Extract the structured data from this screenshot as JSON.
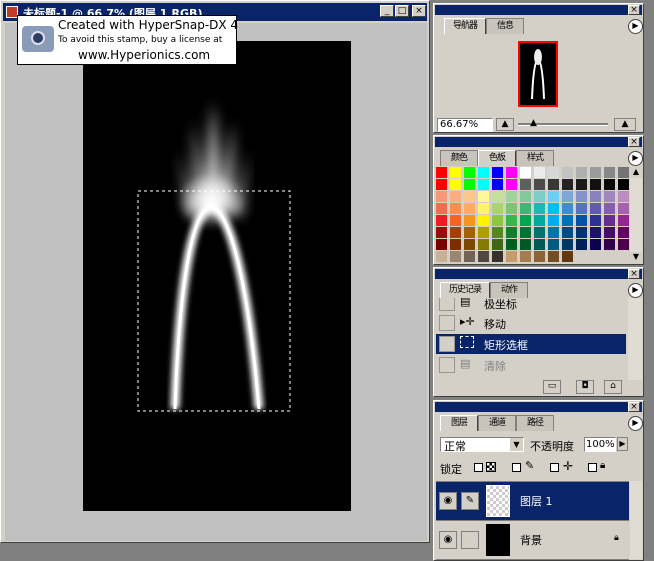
{
  "document_window": {
    "title": "未标题-1 @ 66.7% (图层 1,RGB)",
    "controls": [
      "_",
      "□",
      "×"
    ],
    "watermark": {
      "line1": "Created with HyperSnap-DX 4",
      "line2": "To avoid this stamp, buy a license at",
      "line3": "www.Hyperionics.com"
    }
  },
  "navigator_panel": {
    "tabs": [
      "导航器",
      "信息"
    ],
    "zoom_value": "66.67%",
    "menu_arrow": "▶"
  },
  "swatches_panel": {
    "tabs": [
      "颜色",
      "色板",
      "样式"
    ],
    "colors": [
      [
        "#ff0000",
        "#ffff00",
        "#00ff00",
        "#00ffff",
        "#0000ff",
        "#ff00ff",
        "#ffffff",
        "#ebebeb",
        "#d7d7d7",
        "#c3c3c3",
        "#afafaf",
        "#9b9b9b",
        "#878787",
        "#737373"
      ],
      [
        "#ff0000",
        "#ffff00",
        "#00ff00",
        "#00ffff",
        "#0000ff",
        "#ff00ff",
        "#5f5f5f",
        "#4b4b4b",
        "#373737",
        "#232323",
        "#1a1a1a",
        "#101010",
        "#080808",
        "#000000"
      ],
      [
        "#f7977a",
        "#fbad82",
        "#fdc68c",
        "#fff799",
        "#c4df9b",
        "#a3d39c",
        "#82ca9d",
        "#7bcdc8",
        "#6ecff6",
        "#7ea7d8",
        "#8493ca",
        "#8882be",
        "#a187be",
        "#bc8dbf"
      ],
      [
        "#f26c4f",
        "#f68e55",
        "#fbaf5c",
        "#fff467",
        "#acd372",
        "#7cc576",
        "#3bb878",
        "#1abbb4",
        "#00bff3",
        "#438ccb",
        "#5574b9",
        "#605ca9",
        "#855fa8",
        "#a763a9"
      ],
      [
        "#ed1c24",
        "#f26522",
        "#f7941d",
        "#fff200",
        "#8dc63f",
        "#39b54a",
        "#00a651",
        "#00a99d",
        "#00aeef",
        "#0072bc",
        "#0054a6",
        "#2e3192",
        "#662d91",
        "#92278f"
      ],
      [
        "#9e0b0f",
        "#a0410d",
        "#a3620a",
        "#aba000",
        "#598527",
        "#1a7b30",
        "#007236",
        "#00746b",
        "#0076a3",
        "#004a80",
        "#003471",
        "#1b1464",
        "#440e62",
        "#630460"
      ],
      [
        "#790000",
        "#7b2e00",
        "#7d4900",
        "#827b00",
        "#406618",
        "#005e20",
        "#005826",
        "#005952",
        "#005b7f",
        "#003663",
        "#002157",
        "#0d004c",
        "#32004b",
        "#4b0049"
      ],
      [
        "#c7b299",
        "#998675",
        "#736357",
        "#534741",
        "#37302d",
        "#c69c6e",
        "#a67c52",
        "#8c6239",
        "#754c24",
        "#603913",
        "#d4d0c8",
        "#d4d0c8",
        "#d4d0c8",
        "#d4d0c8"
      ]
    ]
  },
  "history_panel": {
    "tabs": [
      "历史记录",
      "动作"
    ],
    "items": [
      {
        "label": "极坐标",
        "icon": "document-icon"
      },
      {
        "label": "移动",
        "icon": "move-icon"
      },
      {
        "label": "矩形选框",
        "icon": "marquee-icon"
      },
      {
        "label": "清除",
        "icon": "document-icon"
      }
    ]
  },
  "layers_panel": {
    "tabs": [
      "图层",
      "通道",
      "路径"
    ],
    "blend_mode": "正常",
    "opacity_label": "不透明度",
    "opacity_value": "100%",
    "lock_label": "锁定",
    "layers": [
      {
        "name": "图层 1",
        "selected": true
      },
      {
        "name": "背景",
        "selected": false,
        "locked": true
      }
    ]
  },
  "colors": {
    "titlebar": "#0a246a",
    "panel": "#d4d0c8",
    "selection": "#0a246a",
    "workspace": "#808080",
    "canvas": "#000000",
    "nav_frame": "#ff0000"
  }
}
